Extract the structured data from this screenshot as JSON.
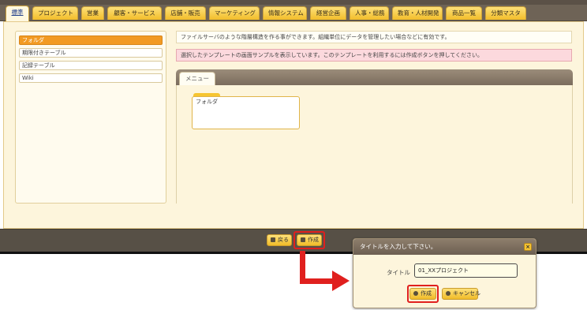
{
  "tabs": [
    {
      "label": "標準",
      "active": true
    },
    {
      "label": "プロジェクト"
    },
    {
      "label": "営業"
    },
    {
      "label": "顧客・サービス"
    },
    {
      "label": "店舗・販売"
    },
    {
      "label": "マーケティング"
    },
    {
      "label": "情報システム"
    },
    {
      "label": "経営企画"
    },
    {
      "label": "人事・総務"
    },
    {
      "label": "教育・人材開発"
    },
    {
      "label": "商品一覧"
    },
    {
      "label": "分類マスタ"
    }
  ],
  "sidebar": {
    "items": [
      {
        "label": "フォルダ",
        "selected": true
      },
      {
        "label": "期限付きテーブル"
      },
      {
        "label": "記録テーブル"
      },
      {
        "label": "Wiki"
      }
    ]
  },
  "main": {
    "description": "ファイルサーバのような階層構造を作る事ができます。組織単位にデータを管理したい場合などに有効です。",
    "notice": "選択したテンプレートの画面サンプルを表示しています。このテンプレートを利用するには作成ボタンを押してください。",
    "menu_tab": "メニュー",
    "card_label": "フォルダ"
  },
  "bottom": {
    "back_label": "戻る",
    "create_label": "作成"
  },
  "dialog": {
    "title": "タイトルを入力して下さい。",
    "close_glyph": "×",
    "title_label": "タイトル",
    "title_value": "01_XXプロジェクト",
    "create_label": "作成",
    "cancel_label": "キャンセル"
  },
  "colors": {
    "accent": "#f29a23",
    "highlight": "#e0201e",
    "tab": "#f2bd2a"
  }
}
